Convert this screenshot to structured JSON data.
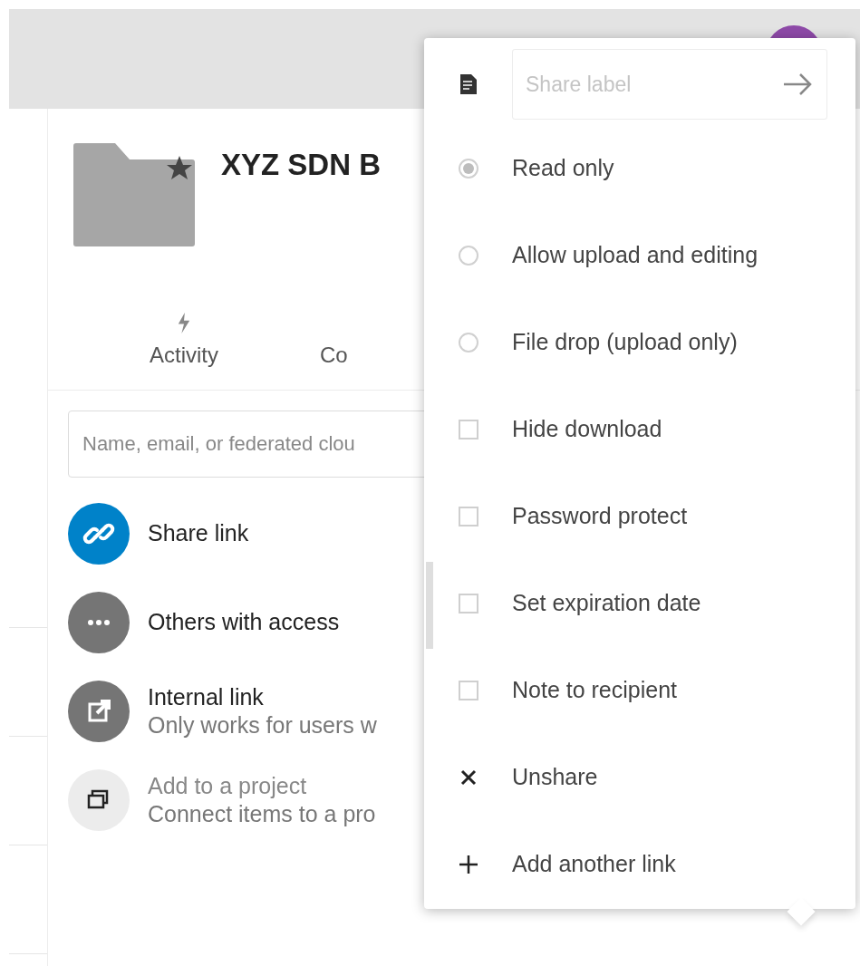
{
  "header": {
    "title": "XYZ SDN B"
  },
  "tabs": [
    {
      "label": "Activity",
      "selected": false,
      "kind": "activity"
    },
    {
      "label": "Co",
      "selected": false,
      "kind": "other"
    }
  ],
  "share_search": {
    "placeholder": "Name, email, or federated clou"
  },
  "share_rows": [
    {
      "kind": "link",
      "title": "Share link"
    },
    {
      "kind": "others",
      "title": "Others with access"
    },
    {
      "kind": "internal",
      "title": "Internal link",
      "subtitle": "Only works for users w"
    },
    {
      "kind": "project",
      "title": "Add to a project",
      "subtitle": "Connect items to a pro"
    }
  ],
  "menu": {
    "label_field": {
      "placeholder": "Share label"
    },
    "items": [
      {
        "kind": "radio",
        "label": "Read only",
        "selected": true
      },
      {
        "kind": "radio",
        "label": "Allow upload and editing",
        "selected": false
      },
      {
        "kind": "radio",
        "label": "File drop (upload only)",
        "selected": false
      },
      {
        "kind": "checkbox",
        "label": "Hide download",
        "checked": false
      },
      {
        "kind": "checkbox",
        "label": "Password protect",
        "checked": false
      },
      {
        "kind": "checkbox",
        "label": "Set expiration date",
        "checked": false
      },
      {
        "kind": "checkbox",
        "label": "Note to recipient",
        "checked": false
      },
      {
        "kind": "remove",
        "label": "Unshare"
      },
      {
        "kind": "add",
        "label": "Add another link"
      }
    ]
  }
}
